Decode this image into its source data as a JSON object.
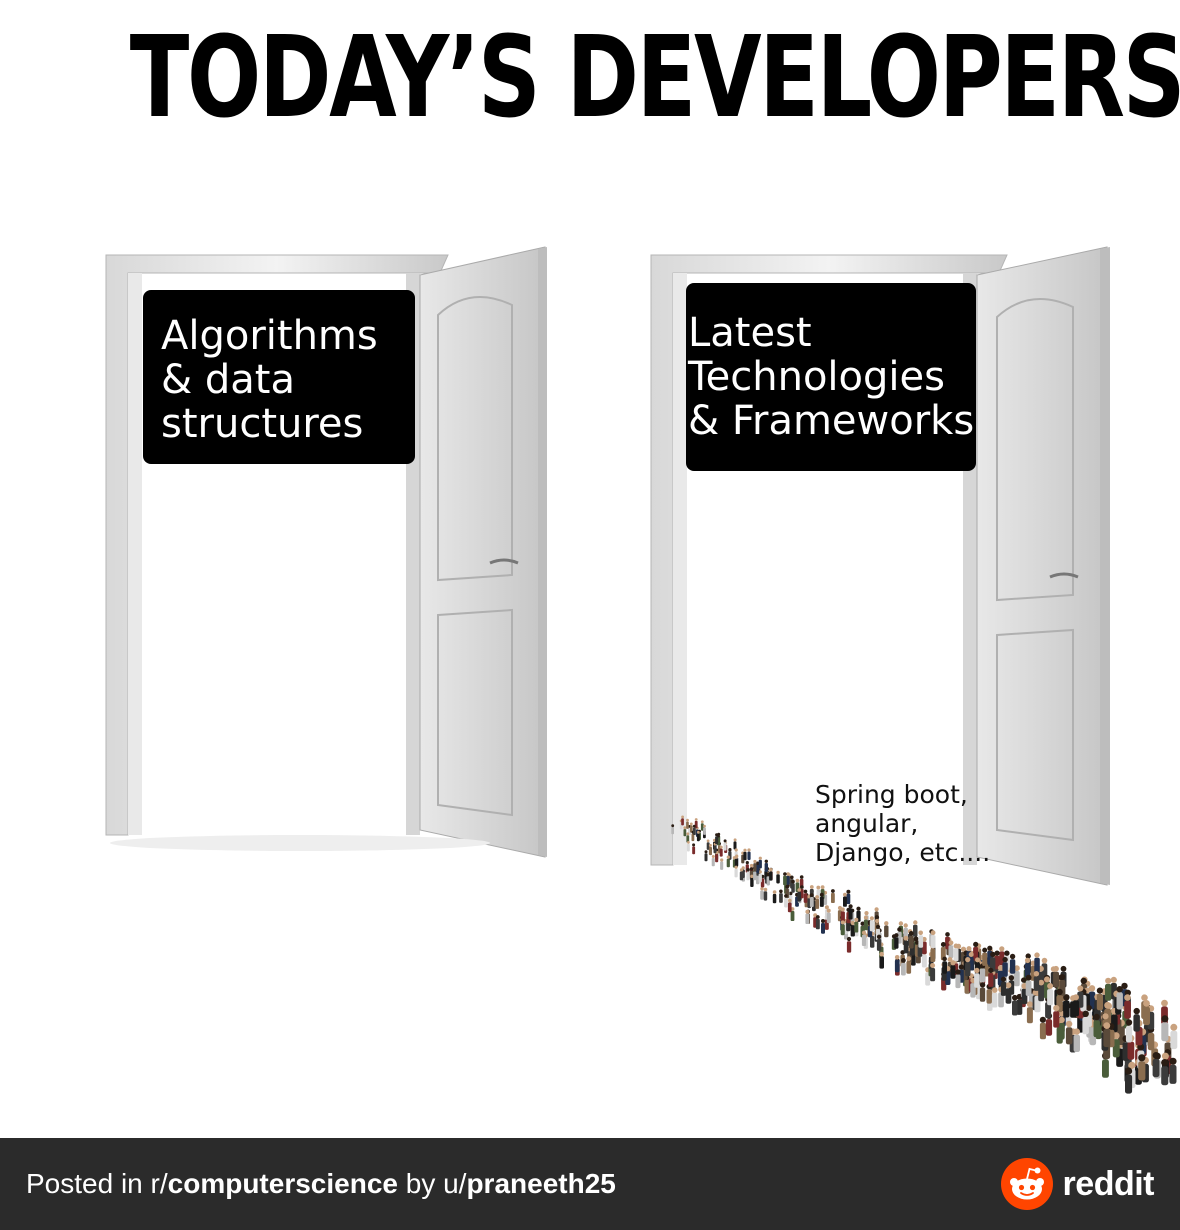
{
  "title": "TODAY’S DEVELOPERS",
  "doors": {
    "left_sign": "Algorithms\n& data\nstructures",
    "right_sign": "Latest\nTechnologies\n& Frameworks"
  },
  "crowd_label": "Spring boot,\nangular,\nDjango, etc....",
  "footer": {
    "prefix": "Posted in r/",
    "subreddit": "computerscience",
    "middle": " by u/",
    "username": "praneeth25",
    "brand": "reddit"
  },
  "colors": {
    "footer_bg": "#2b2b2b",
    "brand_orange": "#ff4500"
  },
  "icons": [
    "reddit-logo-icon"
  ]
}
